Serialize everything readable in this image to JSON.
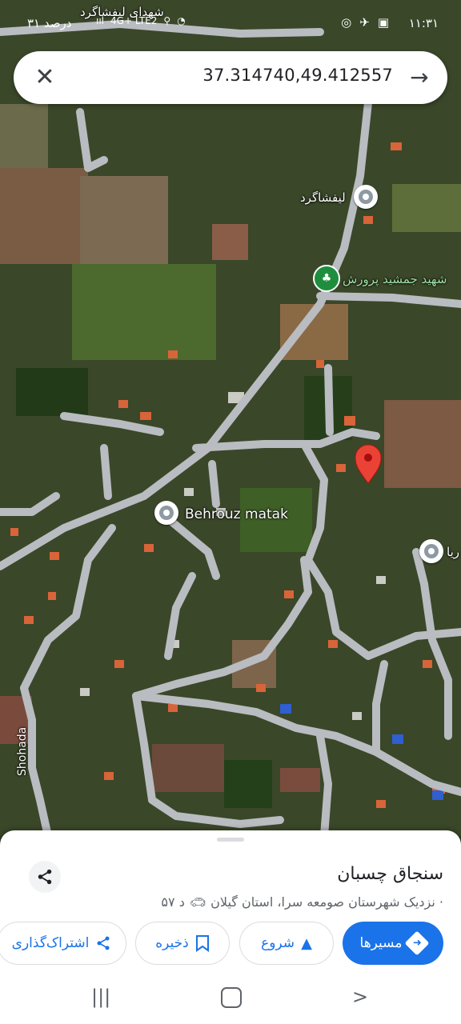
{
  "status": {
    "time": "۱۱:۳۱",
    "battery_text": "۳۱ درصد",
    "network": "4G+ LTE2",
    "top_place": "شهدای لیفشاگرد"
  },
  "search": {
    "coordinates": "37.314740,49.412557",
    "close_icon": "close-icon",
    "go_icon": "arrow-right-icon"
  },
  "map": {
    "labels": {
      "lifshagerd": "لیفشاگرد",
      "shahid_jamshid": "شهید جمشید پرورش",
      "behrouz": "Behrouz matak",
      "right_edge": "ریا",
      "shohada": "Shohada"
    },
    "selected_pin_color": "#ea4335"
  },
  "place": {
    "title": "سنجاق چسبان",
    "subtitle": "نزدیک شهرستان صومعه سرا، استان گیلان ·",
    "drive_time": "۵۷ د"
  },
  "actions": {
    "directions": "مسیرها",
    "start": "شروع",
    "save": "ذخیره",
    "share": "اشتراک‌گذاری"
  },
  "colors": {
    "accent": "#1a73e8",
    "road": "#b9bcc0",
    "pin": "#ea4335"
  }
}
